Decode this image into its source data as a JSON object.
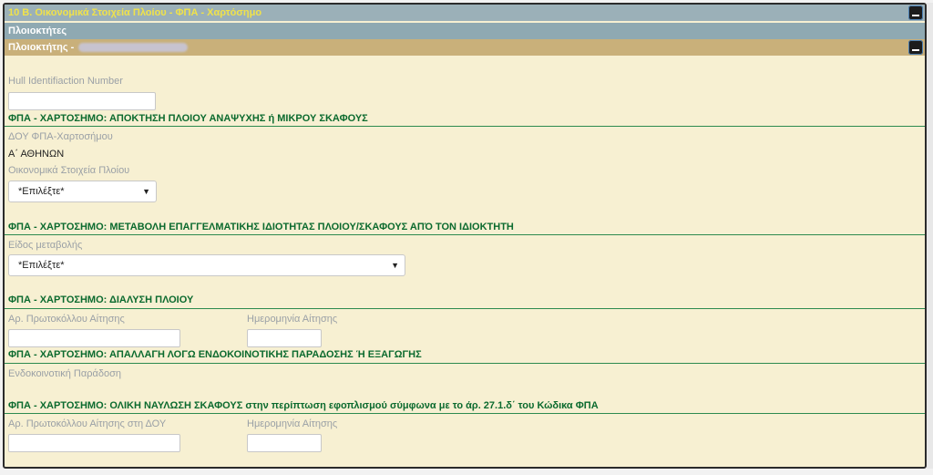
{
  "header": {
    "section_title": "10 Β. Οικονομικά Στοιχεία Πλοίου - ΦΠΑ - Χαρτόσημο",
    "owners_title": "Πλοιοκτήτες",
    "owner_title": "Πλοιοκτήτης -"
  },
  "hull": {
    "label": "Hull Identifiaction Number",
    "value": ""
  },
  "acquisition": {
    "heading": "ΦΠΑ - ΧΑΡΤΟΣΗΜΟ: ΑΠΟΚΤΗΣΗ ΠΛΟΙΟΥ ΑΝΑΨΥΧΗΣ ή ΜΙΚΡΟΥ ΣΚΑΦΟΥΣ",
    "doy_label": "ΔΟΥ ΦΠΑ-Χαρτοσήμου",
    "doy_value": "Α΄ ΑΘΗΝΩΝ",
    "econ_label": "Οικονομικά Στοιχεία Πλοίου",
    "econ_selected": "*Επιλέξτε*"
  },
  "change": {
    "heading": "ΦΠΑ - ΧΑΡΤΟΣΗΜΟ: ΜΕΤΑΒΟΛΗ ΕΠΑΓΓΕΛΜΑΤΙΚΗΣ ΙΔΙΟΤΗΤΑΣ ΠΛΟΙΟΥ/ΣΚΑΦΟΥΣ ΑΠΌ ΤΟΝ ΙΔΙΟΚΤΗΤΗ",
    "type_label": "Είδος μεταβολής",
    "type_selected": "*Επιλέξτε*"
  },
  "dissolution": {
    "heading": "ΦΠΑ - ΧΑΡΤΟΣΗΜΟ: ΔΙΑΛΥΣΗ ΠΛΟΙΟΥ",
    "protocol_label": "Αρ. Πρωτοκόλλου Αίτησης",
    "date_label": "Ημερομηνία Αίτησης"
  },
  "exemption": {
    "heading": "ΦΠΑ - ΧΑΡΤΟΣΗΜΟ: ΑΠΑΛΛΑΓΗ ΛΟΓΩ ΕΝΔΟΚΟΙΝΟΤΙΚΗΣ ΠΑΡΑΔΟΣΗΣ Ή ΕΞΑΓΩΓΗΣ",
    "delivery_label": "Ενδοκοινοτική Παράδοση"
  },
  "charter": {
    "heading": "ΦΠΑ - ΧΑΡΤΟΣΗΜΟ: ΟΛΙΚΗ ΝΑΥΛΩΣΗ ΣΚΑΦΟΥΣ στην περίπτωση εφοπλισμού σύμφωνα με το άρ. 27.1.δ΄ του Κώδικα ΦΠΑ",
    "protocol_label": "Αρ. Πρωτοκόλλου Αίτησης στη ΔΟΥ",
    "date_label": "Ημερομηνία Αίτησης"
  },
  "icons": [
    "collapse-icon",
    "dropdown-arrow-icon"
  ]
}
